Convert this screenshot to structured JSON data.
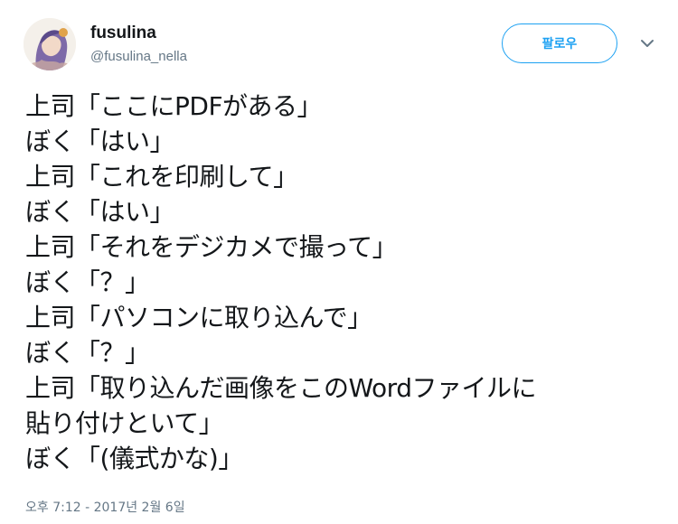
{
  "user": {
    "display_name": "fusulina",
    "handle": "@fusulina_nella",
    "avatar_icon": "avatar-illustration"
  },
  "actions": {
    "follow_label": "팔로우",
    "more_icon": "chevron-down-icon"
  },
  "tweet": {
    "lines": [
      "上司「ここにPDFがある」",
      "ぼく「はい」",
      "上司「これを印刷して」",
      "ぼく「はい」",
      "上司「それをデジカメで撮って」",
      "ぼく「？」",
      "上司「パソコンに取り込んで」",
      "ぼく「？」",
      "上司「取り込んだ画像をこのWordファイルに",
      "貼り付けといて」",
      "ぼく「(儀式かな)」"
    ],
    "timestamp": "오후 7:12 - 2017년 2월 6일"
  },
  "colors": {
    "accent": "#1da1f2",
    "text": "#14171a",
    "secondary": "#657786"
  }
}
